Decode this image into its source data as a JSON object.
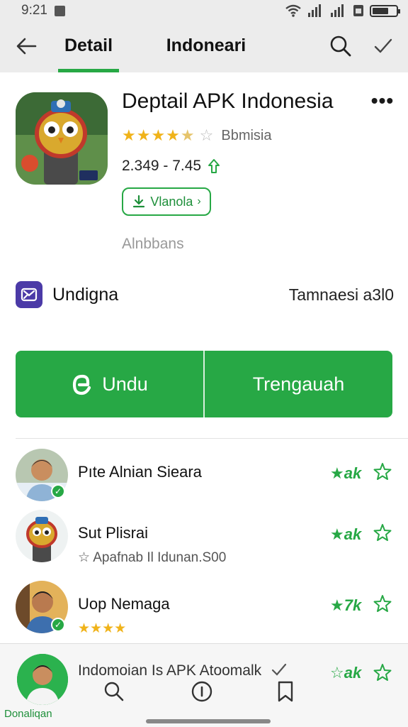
{
  "status": {
    "time": "9:21"
  },
  "tabs": {
    "detail": "Detail",
    "indonesia": "Indoneari"
  },
  "app": {
    "title": "Deptail  APK Indonesia",
    "rating_stars": "★★★★",
    "rating_half": "★",
    "rating_empty": "☆",
    "rating_label": "Bbmisia",
    "version": "2.349 - 7.45",
    "install_label": "Vlanola",
    "sub_label": "Alnbbans"
  },
  "info_row": {
    "label": "Undigna",
    "value": "Tamnaesi a3l0"
  },
  "actions": {
    "primary": "Undu",
    "secondary": "Trengauah"
  },
  "reviews": [
    {
      "name": "Pıte  Alnian Sieara",
      "sub": "",
      "rating": "★ak"
    },
    {
      "name": "Sut  Plisrai",
      "sub": "☆ Apafnab  Il  Idunan.S00",
      "rating": "★ak"
    },
    {
      "name": "Uop  Nemaga",
      "sub": "★★★★",
      "rating": "★7k"
    }
  ],
  "bottom": {
    "avatar_label": "Donaliqan",
    "text": "Indomoian  Is  APK Atoomalk",
    "rating": "☆ak"
  },
  "colors": {
    "accent": "#27a845",
    "star": "#f0b31a",
    "brand_icon": "#4b3aa7"
  }
}
